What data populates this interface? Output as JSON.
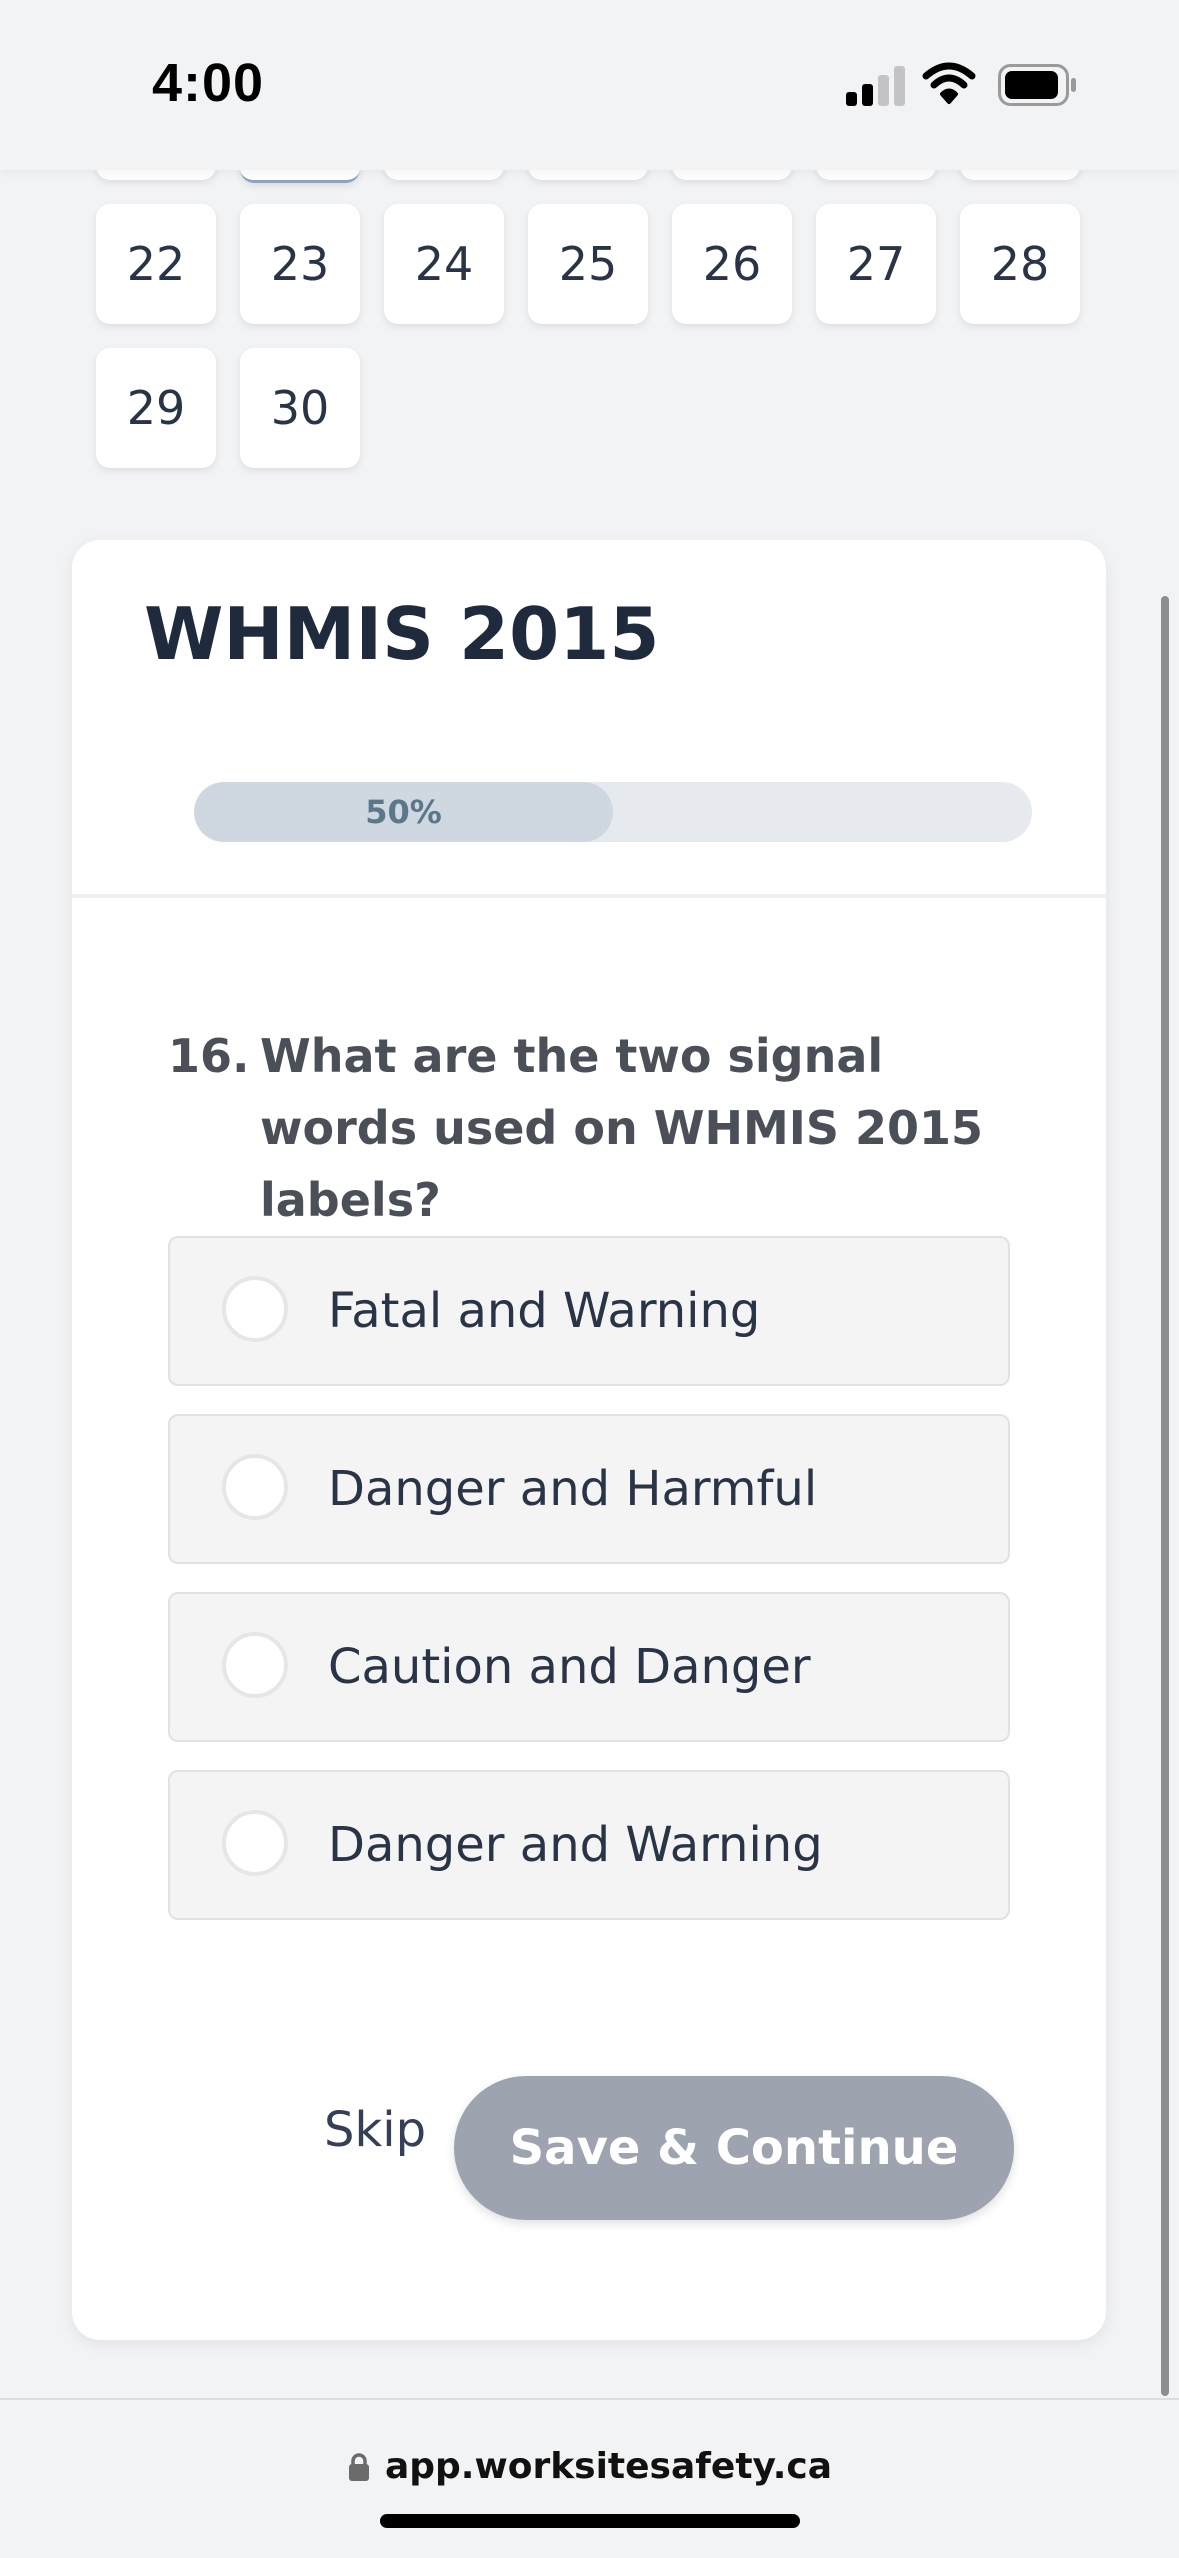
{
  "status_bar": {
    "time": "4:00",
    "icons": [
      "cellular-signal-icon",
      "wifi-icon",
      "battery-icon"
    ]
  },
  "calendar": {
    "rows": [
      [
        "22",
        "23",
        "24",
        "25",
        "26",
        "27",
        "28"
      ],
      [
        "29",
        "30"
      ]
    ]
  },
  "quiz": {
    "title": "WHMIS 2015",
    "progress": {
      "percent": 50,
      "label": "50%"
    },
    "question": {
      "number": "16.",
      "text": "What are the two signal words used on WHMIS 2015 labels?"
    },
    "options": [
      {
        "label": "Fatal and Warning",
        "selected": false
      },
      {
        "label": "Danger and Harmful",
        "selected": false
      },
      {
        "label": "Caution and Danger",
        "selected": false
      },
      {
        "label": "Danger and Warning",
        "selected": false
      }
    ],
    "skip_label": "Skip",
    "save_label": "Save & Continue"
  },
  "browser": {
    "url": "app.worksitesafety.ca",
    "lock_icon": "lock-icon"
  },
  "colors": {
    "page_bg": "#f2f3f5",
    "title": "#1f2a3d",
    "progress_track": "#e6eaee",
    "progress_fill": "#cfd7e0",
    "progress_text": "#5c7789",
    "button_disabled": "#9da3af"
  }
}
